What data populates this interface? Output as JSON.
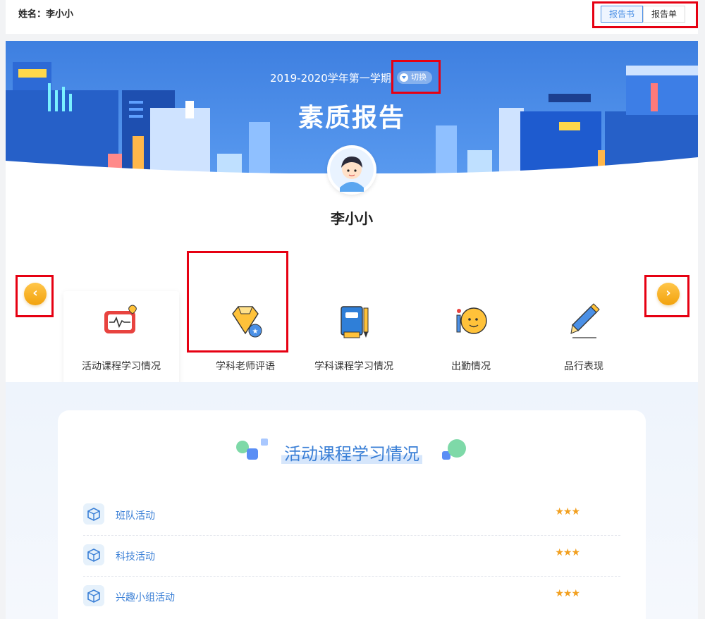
{
  "header": {
    "name_label": "姓名：李小小",
    "toggle": [
      {
        "label": "报告书",
        "active": true
      },
      {
        "label": "报告单",
        "active": false
      }
    ]
  },
  "banner": {
    "term": "2019-2020学年第一学期",
    "switch_label": "切换",
    "title": "素质报告"
  },
  "student": {
    "name": "李小小"
  },
  "nav": {
    "prev": "‹",
    "next": "›"
  },
  "tabs": [
    {
      "label": "活动课程学习情况",
      "icon": "heart-monitor-icon",
      "active": true
    },
    {
      "label": "学科老师评语",
      "icon": "diamond-badge-icon",
      "active": false
    },
    {
      "label": "学科课程学习情况",
      "icon": "notebook-pencil-icon",
      "active": false
    },
    {
      "label": "出勤情况",
      "icon": "attendance-face-icon",
      "active": false
    },
    {
      "label": "品行表现",
      "icon": "pen-signature-icon",
      "active": false
    }
  ],
  "section": {
    "title": "活动课程学习情况",
    "rows": [
      {
        "label": "班队活动",
        "stars": "★★★",
        "rating": 3
      },
      {
        "label": "科技活动",
        "stars": "★★★",
        "rating": 3
      },
      {
        "label": "兴趣小组活动",
        "stars": "★★★",
        "rating": 3
      }
    ]
  },
  "colors": {
    "accent": "#4b90e6",
    "banner": "#3e7fe0",
    "star": "#f2a020",
    "highlight": "#e60012"
  }
}
